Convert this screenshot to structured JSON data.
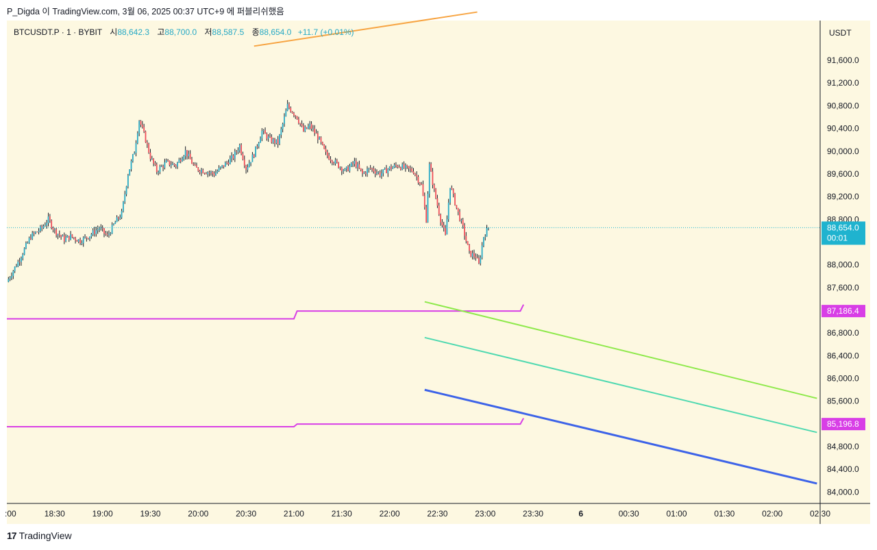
{
  "header": {
    "title": "P_Digda 이 TradingView.com, 3월 06, 2025 00:37 UTC+9 에 퍼블리쉬했음"
  },
  "legend": {
    "symbol": "BTCUSDT.P · 1 · BYBIT",
    "open_label": "시",
    "open": "88,642.3",
    "high_label": "고",
    "high": "88,700.0",
    "low_label": "저",
    "low": "88,587.5",
    "close_label": "종",
    "close": "88,654.0",
    "change": "+11.7 (+0.01%)"
  },
  "footer": {
    "logo": "17",
    "brand": "TradingView"
  },
  "colors": {
    "bg": "#fdf8e1",
    "up": "#26a9c5",
    "down": "#ef4f5a",
    "wick": "#131722",
    "magenta": "#d83ee6",
    "orange": "#f7a442",
    "green": "#8ee94b",
    "teal": "#4fd9b0",
    "blue": "#3d63e8",
    "price_tag": "#1fb3cf"
  },
  "chart_data": {
    "type": "candlestick",
    "currency": "USDT",
    "x_tick_labels": [
      ":00",
      "18:30",
      "19:00",
      "19:30",
      "20:00",
      "20:30",
      "21:00",
      "21:30",
      "22:00",
      "22:30",
      "23:00",
      "23:30",
      "6",
      "00:30",
      "01:00",
      "01:30",
      "02:00",
      "02:30"
    ],
    "y_tick_labels": [
      "91,600.0",
      "91,200.0",
      "90,800.0",
      "90,400.0",
      "90,000.0",
      "89,600.0",
      "89,200.0",
      "88,800.0",
      "88,000.0",
      "87,600.0",
      "86,800.0",
      "86,400.0",
      "86,000.0",
      "85,600.0",
      "84,800.0",
      "84,400.0",
      "84,000.0"
    ],
    "y_ticks": [
      91600,
      91200,
      90800,
      90400,
      90000,
      89600,
      89200,
      88800,
      88000,
      87600,
      86800,
      86400,
      86000,
      85600,
      84800,
      84400,
      84000
    ],
    "ylim": [
      83800,
      92300
    ],
    "xlim_minutes": [
      1080,
      1590
    ],
    "close_path": [
      [
        1080,
        87700
      ],
      [
        1088,
        88100
      ],
      [
        1095,
        88500
      ],
      [
        1102,
        88650
      ],
      [
        1106,
        88800
      ],
      [
        1110,
        88600
      ],
      [
        1116,
        88450
      ],
      [
        1120,
        88500
      ],
      [
        1126,
        88420
      ],
      [
        1132,
        88520
      ],
      [
        1138,
        88650
      ],
      [
        1143,
        88500
      ],
      [
        1148,
        88750
      ],
      [
        1152,
        88900
      ],
      [
        1156,
        89600
      ],
      [
        1160,
        90000
      ],
      [
        1163,
        90550
      ],
      [
        1166,
        90300
      ],
      [
        1170,
        89900
      ],
      [
        1174,
        89650
      ],
      [
        1180,
        89800
      ],
      [
        1186,
        89750
      ],
      [
        1192,
        90000
      ],
      [
        1198,
        89700
      ],
      [
        1204,
        89650
      ],
      [
        1210,
        89600
      ],
      [
        1216,
        89750
      ],
      [
        1222,
        89900
      ],
      [
        1226,
        90100
      ],
      [
        1230,
        89700
      ],
      [
        1235,
        89950
      ],
      [
        1240,
        90350
      ],
      [
        1245,
        90200
      ],
      [
        1250,
        90150
      ],
      [
        1256,
        90800
      ],
      [
        1262,
        90600
      ],
      [
        1266,
        90350
      ],
      [
        1270,
        90450
      ],
      [
        1275,
        90250
      ],
      [
        1280,
        89950
      ],
      [
        1286,
        89800
      ],
      [
        1292,
        89650
      ],
      [
        1298,
        89800
      ],
      [
        1303,
        89600
      ],
      [
        1308,
        89700
      ],
      [
        1314,
        89600
      ],
      [
        1320,
        89700
      ],
      [
        1325,
        89750
      ],
      [
        1330,
        89700
      ],
      [
        1335,
        89650
      ],
      [
        1340,
        89400
      ],
      [
        1343,
        88800
      ],
      [
        1345,
        89750
      ],
      [
        1348,
        89300
      ],
      [
        1352,
        88800
      ],
      [
        1355,
        88500
      ],
      [
        1358,
        89400
      ],
      [
        1362,
        89000
      ],
      [
        1366,
        88650
      ],
      [
        1370,
        88200
      ],
      [
        1374,
        88150
      ],
      [
        1376,
        88000
      ],
      [
        1379,
        88500
      ],
      [
        1382,
        88654
      ]
    ],
    "lines": [
      {
        "name": "",
        "kind": "resistance",
        "points": [
          [
            1080,
            87050
          ],
          [
            1260,
            87050
          ],
          [
            1262,
            87186.4
          ],
          [
            1402,
            87186.4
          ],
          [
            1404,
            87300
          ]
        ]
      },
      {
        "name": "",
        "kind": "support",
        "points": [
          [
            1080,
            85150
          ],
          [
            1260,
            85150
          ],
          [
            1262,
            85196.8
          ],
          [
            1402,
            85196.8
          ],
          [
            1404,
            85300
          ]
        ]
      },
      {
        "name": "",
        "kind": "trend",
        "color": "orange",
        "points": [
          [
            1235,
            91850
          ],
          [
            1375,
            92450
          ]
        ]
      },
      {
        "name": "",
        "kind": "trend",
        "color": "green",
        "points": [
          [
            1342,
            87350
          ],
          [
            1588,
            85650
          ]
        ]
      },
      {
        "name": "",
        "kind": "trend",
        "color": "teal",
        "points": [
          [
            1342,
            86720
          ],
          [
            1588,
            85050
          ]
        ]
      },
      {
        "name": "",
        "kind": "trend",
        "color": "blue",
        "points": [
          [
            1342,
            85800
          ],
          [
            1588,
            84150
          ]
        ]
      }
    ],
    "price_tags": [
      {
        "value": 88654.0,
        "label": "88,654.0",
        "sub": "00:01",
        "kind": "last"
      },
      {
        "value": 87186.4,
        "label": "87,186.4",
        "kind": "magenta"
      },
      {
        "value": 85196.8,
        "label": "85,196.8",
        "kind": "magenta"
      }
    ],
    "grid": false,
    "legend_placement": "top-left"
  }
}
